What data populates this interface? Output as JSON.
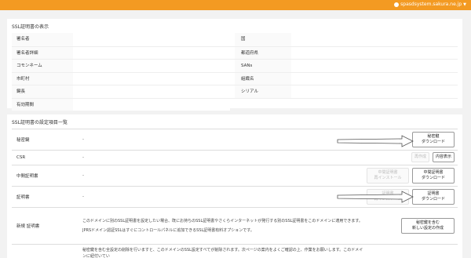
{
  "header": {
    "account": "spasdsystem.sakura.ne.jp",
    "colors": {
      "topbar": "#f39a22"
    }
  },
  "cert_info": {
    "title": "SSL証明書の表示",
    "left_labels": [
      "署名者",
      "署名者詳細",
      "コモンネーム",
      "市町村",
      "鍵長",
      "有効期間"
    ],
    "right_labels": [
      "国",
      "都道府県",
      "SANs",
      "組織名",
      "シリアル"
    ]
  },
  "settings": {
    "title": "SSL証明書の設定項目一覧",
    "rows": [
      {
        "label": "秘密鍵",
        "value": "-",
        "btn1": "秘密鍵",
        "btn2": "ダウンロード"
      },
      {
        "label": "CSR",
        "value": "-",
        "btn_reissue": "再作成",
        "btn_view": "内容表示"
      },
      {
        "label": "中間証明書",
        "value": "-",
        "btn_install_1": "中間証明書",
        "btn_install_2": "再インストール",
        "btn1": "中間証明書",
        "btn2": "ダウンロード"
      },
      {
        "label": "証明書",
        "value": "-",
        "btn_install_1": "証明書",
        "btn_install_2": "再インストール",
        "btn1": "証明書",
        "btn2": "ダウンロード"
      },
      {
        "label": "新規 証明書",
        "desc1": "このドメインに別のSSL証明書を設定したい場合、既にお持ちのSSL証明書やさくらインターネットが発行する別のSSL証明書をこのドメインに適用できます。",
        "desc2": "JPRSドメイン認証SSLはすぐにコントロールパネルに追加できるSSL証明書有料オプションです。",
        "btn1": "秘密鍵を含む",
        "btn2": "新しい設定の作成"
      },
      {
        "desc1": "秘密鍵を含む全設定の削除を行いますと、このドメインのSSL設定すべてが削除されます。次ページの案内をよくご確認の上、作業をお願いします。このドメインに紐付いてい"
      }
    ]
  }
}
